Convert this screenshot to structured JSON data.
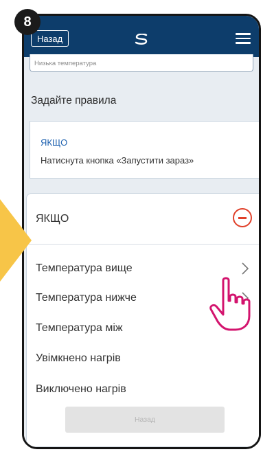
{
  "step_badge": "8",
  "header": {
    "back_label": "Назад",
    "logo_icon": "s-logo-icon",
    "menu_icon": "hamburger-icon",
    "bg_color": "#0d3d6b"
  },
  "previous_card": {
    "text": "Низька температура"
  },
  "section_title": "Задайте правила",
  "if_card": {
    "title": "ЯКЩО",
    "description": "Натиснута кнопка «Запустити зараз»"
  },
  "panel": {
    "title": "ЯКЩО",
    "remove_icon": "minus-circle-icon",
    "remove_color": "#e0402a",
    "options": [
      {
        "label": "Температура вище"
      },
      {
        "label": "Температура нижче"
      },
      {
        "label": "Температура між"
      },
      {
        "label": "Увімкнено нагрів"
      },
      {
        "label": "Виключено нагрів"
      }
    ],
    "footer_button": "Назад"
  },
  "overlay": {
    "pointer_icon": "hand-pointer-icon",
    "pointer_color": "#d3146e",
    "arrow_color": "#f7c548"
  }
}
